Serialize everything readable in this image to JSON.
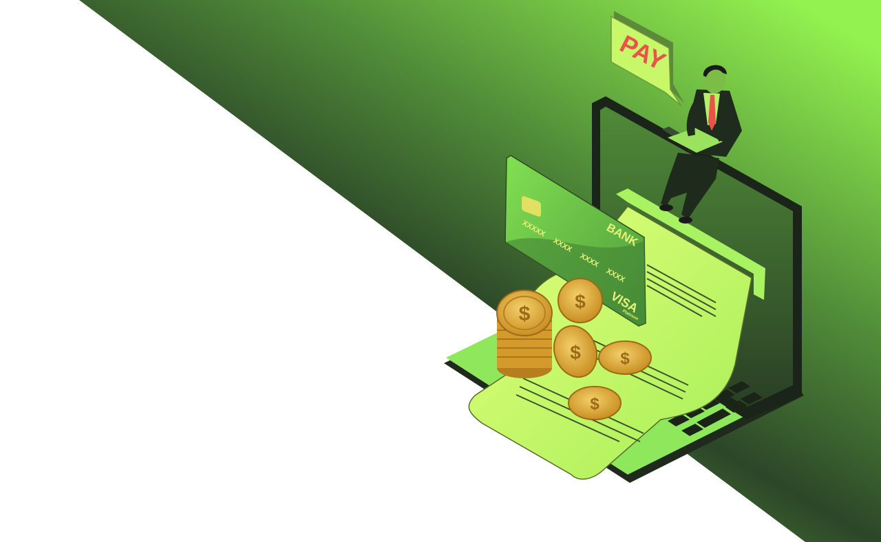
{
  "illustration": {
    "speech_bubble": {
      "text": "PAY",
      "text_color": "#e8544a",
      "fill": "#c9f76a"
    },
    "credit_card": {
      "bank": "BANK",
      "numbers": [
        "XXXXX",
        "XXXX",
        "XXXX",
        "XXXX"
      ],
      "brand": "VISA",
      "tier": "Platinum",
      "fill": "#7fd94e"
    },
    "coin_symbol": "$",
    "colors": {
      "bg_dark": "#2f4a2a",
      "bg_light": "#8ef04e",
      "laptop_body": "#8ee85a",
      "receipt": "#d7fb72",
      "coin": "#e6b13a"
    }
  }
}
